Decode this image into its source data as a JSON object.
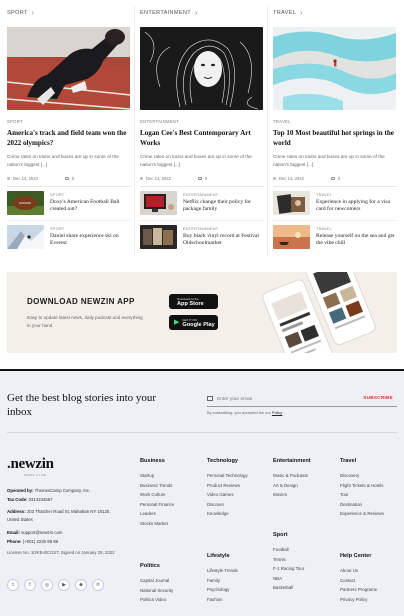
{
  "columns": [
    {
      "heading": "SPORT",
      "hero": {
        "category": "SPORT",
        "title": "America's track and field team won the 2022 olympics?",
        "excerpt": "Crime rates on trains and buses are up in some of the nation's biggest [...]",
        "date": "Dec 14, 2022",
        "comments": "0"
      },
      "minis": [
        {
          "category": "SPORT",
          "title": "Doxy's American Football Ball created out?"
        },
        {
          "category": "SPORT",
          "title": "Daniel share experience ski on Everest"
        }
      ]
    },
    {
      "heading": "ENTERTAINMENT",
      "hero": {
        "category": "ENTERTAINMENT",
        "title": "Logan Cee's Best Contemporary Art Works",
        "excerpt": "Crime rates on trains and buses are up in some of the nation's biggest [...]",
        "date": "Dec 14, 2022",
        "comments": "0"
      },
      "minis": [
        {
          "category": "ENTERTAINMENT",
          "title": "Netflix change their policy for package family"
        },
        {
          "category": "ENTERTAINMENT",
          "title": "Buy black vinyl record at Festival Oldschoolmarket"
        }
      ]
    },
    {
      "heading": "TRAVEL",
      "hero": {
        "category": "TRAVEL",
        "title": "Top 10 Most beautiful hot springs in the world",
        "excerpt": "Crime rates on trains and buses are up in some of the nation's biggest [...]",
        "date": "Dec 14, 2022",
        "comments": "0"
      },
      "minis": [
        {
          "category": "TRAVEL",
          "title": "Experience in applying for a visa card for newcomers"
        },
        {
          "category": "TRAVEL",
          "title": "Release yourself on the sea and get the vibe chill"
        }
      ]
    }
  ],
  "banner": {
    "title": "DOWNLOAD NEWZIN APP",
    "description": "Easy to update latest news, daily podcast and everything in your hand",
    "app_store_small": "Download on the",
    "app_store": "App Store",
    "google_play_small": "GET IT ON",
    "google_play": "Google Play"
  },
  "footer": {
    "newsletter_title": "Get the best blog stories into your inbox",
    "email_placeholder": "Enter your email",
    "subscribe_label": "SUBSCRIBE",
    "consent_prefix": "By subscribing, you accepted the our",
    "consent_link": "Policy",
    "logo": ".newzin",
    "logo_sub": "NEWS CLUB",
    "operated": {
      "label": "Operated by:",
      "value": "ThemesCamp Company, Inc."
    },
    "tax": {
      "label": "Tax Code:",
      "value": "0314234567"
    },
    "address": {
      "label": "Address:",
      "value": "203 Thatcher Road St, Mahattan NY 10120, United States"
    },
    "email": {
      "label": "Email:",
      "value": "support@newzin.com"
    },
    "phone": {
      "label": "Phone:",
      "value": "(+001) 2235 99 88"
    },
    "license": "License No. 10/KB-BCGST, Signed on January 29, 2022",
    "socials": [
      "twitter-icon",
      "facebook-icon",
      "instagram-icon",
      "youtube-icon",
      "reddit-icon",
      "pinterest-icon"
    ],
    "groups": [
      {
        "heading": "Business",
        "links": [
          "Startup",
          "Business Trends",
          "Work Culture",
          "Personal Finance",
          "Leaders",
          "Stocks Market"
        ]
      },
      {
        "heading": "Technology",
        "links": [
          "Personal Technology",
          "Product Reviews",
          "Video Games",
          "Discover",
          "Knowledge"
        ]
      },
      {
        "heading": "Entertainment",
        "links": [
          "Music & Podcasts",
          "Art & Design",
          "Movies"
        ]
      },
      {
        "heading": "Travel",
        "links": [
          "Discovery",
          "Flight Tickets & Hotels",
          "Tour",
          "Destination",
          "Experience & Reviews"
        ]
      },
      {
        "heading": "Politics",
        "links": [
          "Capital Journal",
          "National Security",
          "Politics Video"
        ]
      },
      {
        "heading": "Lifestyle",
        "links": [
          "Lifestyle Trends",
          "Family",
          "Psychology",
          "Fashion"
        ]
      },
      {
        "heading": "Sport",
        "links": [
          "Football",
          "Tennis",
          "F-1 Racing Tour",
          "NBA",
          "Basketball"
        ]
      },
      {
        "heading": "Help Center",
        "links": [
          "About Us",
          "Contact",
          "Partners Programe",
          "Privacy Policy"
        ]
      }
    ]
  }
}
